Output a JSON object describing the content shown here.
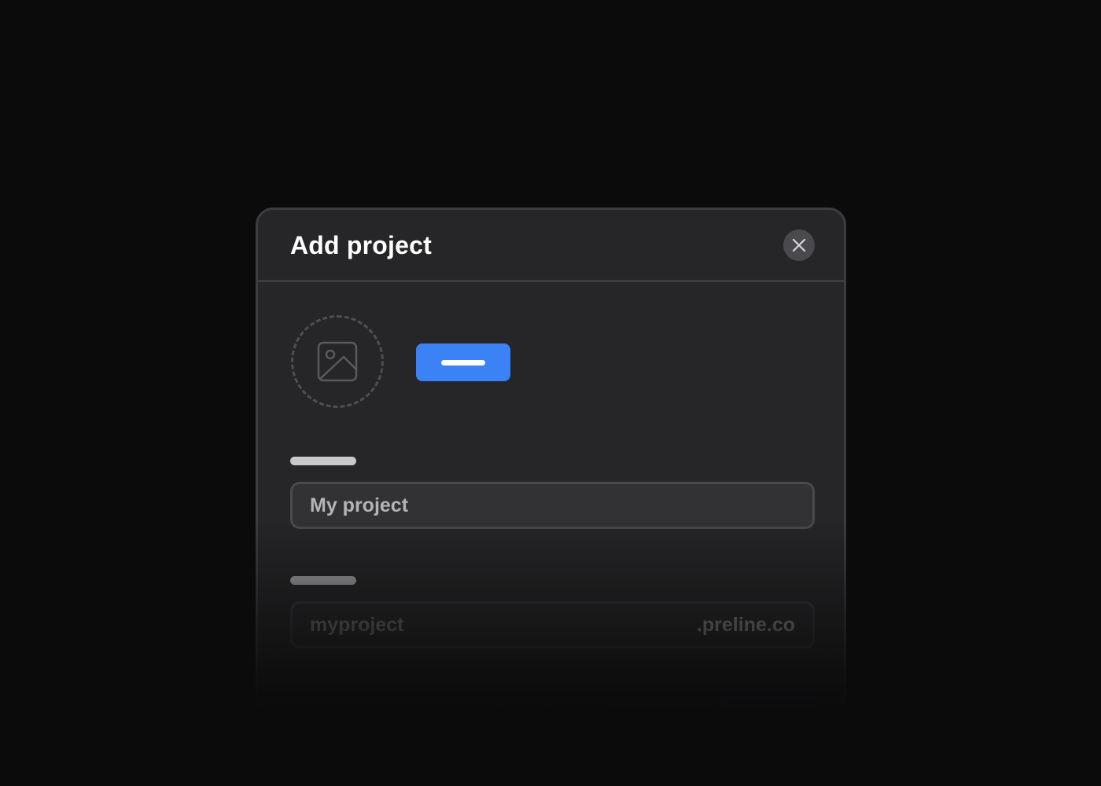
{
  "modal": {
    "title": "Add project",
    "close_icon": "close-icon",
    "avatar_icon": "image-icon",
    "upload_button_label": "",
    "fields": {
      "name": {
        "value": "My project"
      },
      "slug": {
        "value": "myproject",
        "suffix": ".preline.co"
      }
    },
    "footer": {
      "cancel_label": "",
      "save_label": ""
    }
  },
  "colors": {
    "background": "#0b0b0c",
    "modal": "#262628",
    "border": "#3d3d40",
    "accent": "#3b82f6"
  }
}
